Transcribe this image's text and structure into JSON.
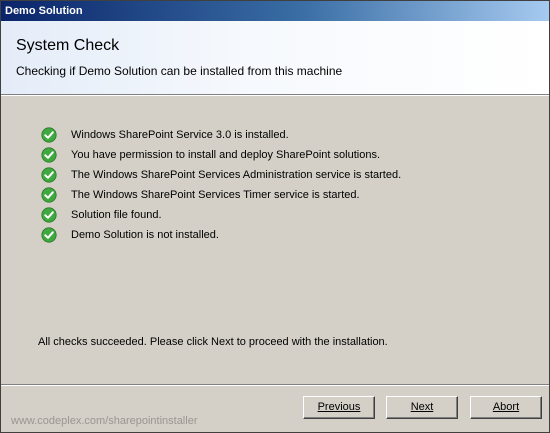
{
  "window": {
    "title": "Demo Solution"
  },
  "header": {
    "title": "System Check",
    "subtitle": "Checking if Demo Solution can be installed from this machine"
  },
  "checks": [
    {
      "icon": "green-check-icon",
      "text": "Windows SharePoint Service 3.0 is installed."
    },
    {
      "icon": "green-check-icon",
      "text": "You have permission to install and deploy SharePoint solutions."
    },
    {
      "icon": "green-check-icon",
      "text": "The Windows SharePoint Services Administration service is started."
    },
    {
      "icon": "green-check-icon",
      "text": "The Windows SharePoint Services Timer service is started."
    },
    {
      "icon": "green-check-icon",
      "text": "Solution file found."
    },
    {
      "icon": "green-check-icon",
      "text": "Demo Solution is not installed."
    }
  ],
  "status": "All checks succeeded. Please click Next to proceed with the installation.",
  "footer": {
    "watermark": "www.codeplex.com/sharepointinstaller",
    "buttons": {
      "previous": "Previous",
      "next": "Next",
      "abort": "Abort"
    }
  },
  "colors": {
    "titlebar_start": "#0a246a",
    "titlebar_end": "#a6caf0",
    "check_green": "#3fa83f",
    "dialog_bg": "#d4d0c8"
  }
}
